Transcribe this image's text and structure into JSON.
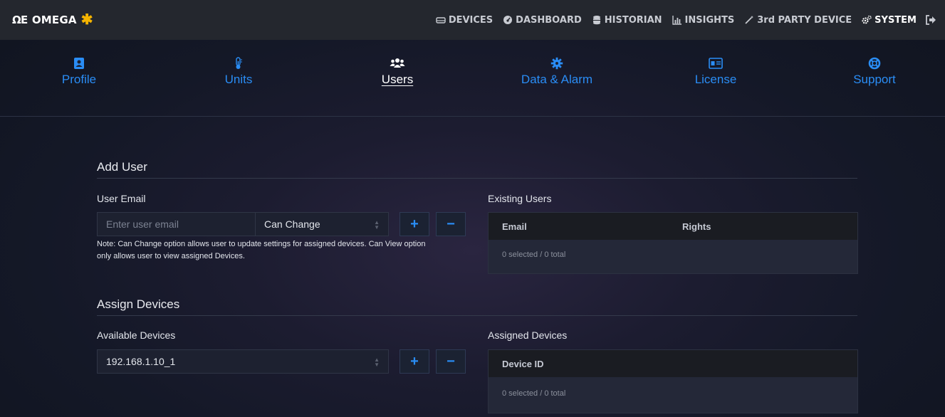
{
  "brand": {
    "name": "OMEGA",
    "mark": "✱"
  },
  "nav": {
    "items": [
      {
        "label": "DEVICES",
        "icon": "hdd-icon"
      },
      {
        "label": "DASHBOARD",
        "icon": "gauge-icon"
      },
      {
        "label": "HISTORIAN",
        "icon": "database-icon"
      },
      {
        "label": "INSIGHTS",
        "icon": "bar-chart-icon"
      },
      {
        "label": "3rd PARTY DEVICE",
        "icon": "magic-wand-icon"
      },
      {
        "label": "SYSTEM",
        "icon": "cogs-icon"
      }
    ],
    "active": "SYSTEM"
  },
  "tabs": [
    {
      "label": "Profile",
      "icon": "address-book-icon"
    },
    {
      "label": "Units",
      "icon": "thermometer-icon"
    },
    {
      "label": "Users",
      "icon": "users-icon"
    },
    {
      "label": "Data & Alarm",
      "icon": "gear-icon"
    },
    {
      "label": "License",
      "icon": "id-card-icon"
    },
    {
      "label": "Support",
      "icon": "life-ring-icon"
    }
  ],
  "active_tab": "Users",
  "add_user": {
    "title": "Add User",
    "email_label": "User Email",
    "email_placeholder": "Enter user email",
    "email_value": "",
    "rights_value": "Can Change",
    "add_symbol": "+",
    "remove_symbol": "−",
    "note_line1": "Note: Can Change option allows user to update settings for assigned devices. Can View option",
    "note_line2": "only allows user to view assigned Devices.",
    "existing_label": "Existing Users",
    "table_headers": [
      "Email",
      "Rights"
    ],
    "table_footer": "0 selected / 0 total"
  },
  "assign_devices": {
    "title": "Assign Devices",
    "available_label": "Available Devices",
    "selected_device": "192.168.1.10_1",
    "add_symbol": "+",
    "remove_symbol": "−",
    "assigned_label": "Assigned Devices",
    "table_headers": [
      "Device ID"
    ],
    "table_footer": "0 selected / 0 total"
  },
  "colors": {
    "accent": "#2a8df5",
    "topbar": "#24272e",
    "logo_star": "#f5b400",
    "table_header": "#1a1c22"
  }
}
